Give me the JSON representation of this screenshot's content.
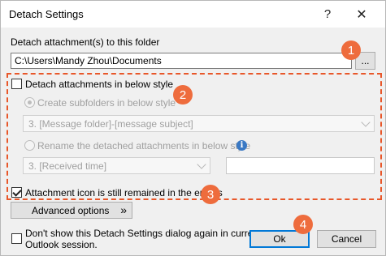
{
  "window": {
    "title": "Detach Settings",
    "help_glyph": "?",
    "close_glyph": "✕"
  },
  "folder": {
    "label": "Detach attachment(s) to this folder",
    "path": "C:\\Users\\Mandy Zhou\\Documents",
    "browse_label": "..."
  },
  "style_section": {
    "detach_in_style_label": "Detach attachments in below style",
    "detach_in_style_checked": false,
    "subfolders_label": "Create subfolders in below style",
    "subfolders_selected": true,
    "subfolder_style_value": "3. [Message folder]-[message subject]",
    "rename_label": "Rename the detached attachments in below style",
    "rename_selected": false,
    "rename_style_value": "3. [Received time]",
    "rename_extra_value": ""
  },
  "options": {
    "icon_remained_label": "Attachment icon is still remained in the emails",
    "icon_remained_checked": true,
    "advanced_label": "Advanced options",
    "advanced_chevron": "»",
    "dont_show_label_line1": "Don't show this Detach Settings dialog again in current",
    "dont_show_label_line2": "Outlook session.",
    "dont_show_checked": false
  },
  "buttons": {
    "ok_label": "Ok",
    "cancel_label": "Cancel"
  },
  "callouts": [
    "1",
    "2",
    "3",
    "4"
  ],
  "colors": {
    "callout": "#ee6c3d",
    "dashed_frame": "#e8572a",
    "primary_border": "#0078d7",
    "info_icon": "#3a79c4"
  },
  "icons": {
    "info": "info-icon",
    "close": "close-icon",
    "help": "help-icon"
  }
}
